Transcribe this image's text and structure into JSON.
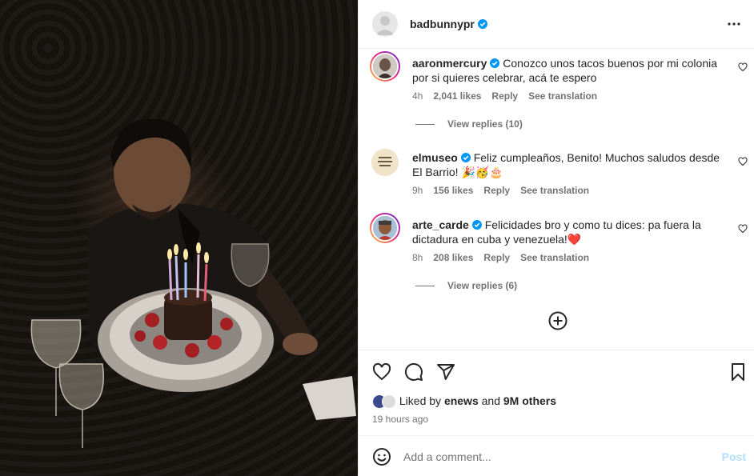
{
  "post": {
    "author": "badbunnypr",
    "author_verified": true
  },
  "comments": [
    {
      "username": "aaronmercury",
      "text": "Conozco unos tacos buenos por mi colonia por si quieres celebrar, acá te espero",
      "time": "4h",
      "likes": "2,041 likes",
      "reply": "Reply",
      "translate": "See translation",
      "view_replies": "View replies (10)"
    },
    {
      "username": "elmuseo",
      "text": "Feliz cumpleaños, Benito! Muchos saludos desde El Barrio! 🎉🥳🎂",
      "time": "9h",
      "likes": "156 likes",
      "reply": "Reply",
      "translate": "See translation"
    },
    {
      "username": "arte_carde",
      "text": "Felicidades bro y como tu dices: pa fuera la dictadura en cuba y venezuela!❤️",
      "time": "8h",
      "likes": "208 likes",
      "reply": "Reply",
      "translate": "See translation",
      "view_replies": "View replies (6)"
    }
  ],
  "likes_line": {
    "prefix": "Liked by ",
    "user": "enews",
    "mid": " and ",
    "count": "9M others"
  },
  "timestamp": "19 hours ago",
  "add_comment": {
    "placeholder": "Add a comment...",
    "post_label": "Post"
  },
  "colors": {
    "verified": "#0095f6",
    "link_muted": "#737373",
    "post_disabled": "#b2dffc"
  },
  "icons": [
    "heart-icon",
    "comment-icon",
    "share-icon",
    "bookmark-icon",
    "more-icon",
    "emoji-icon",
    "add-circle-icon"
  ]
}
